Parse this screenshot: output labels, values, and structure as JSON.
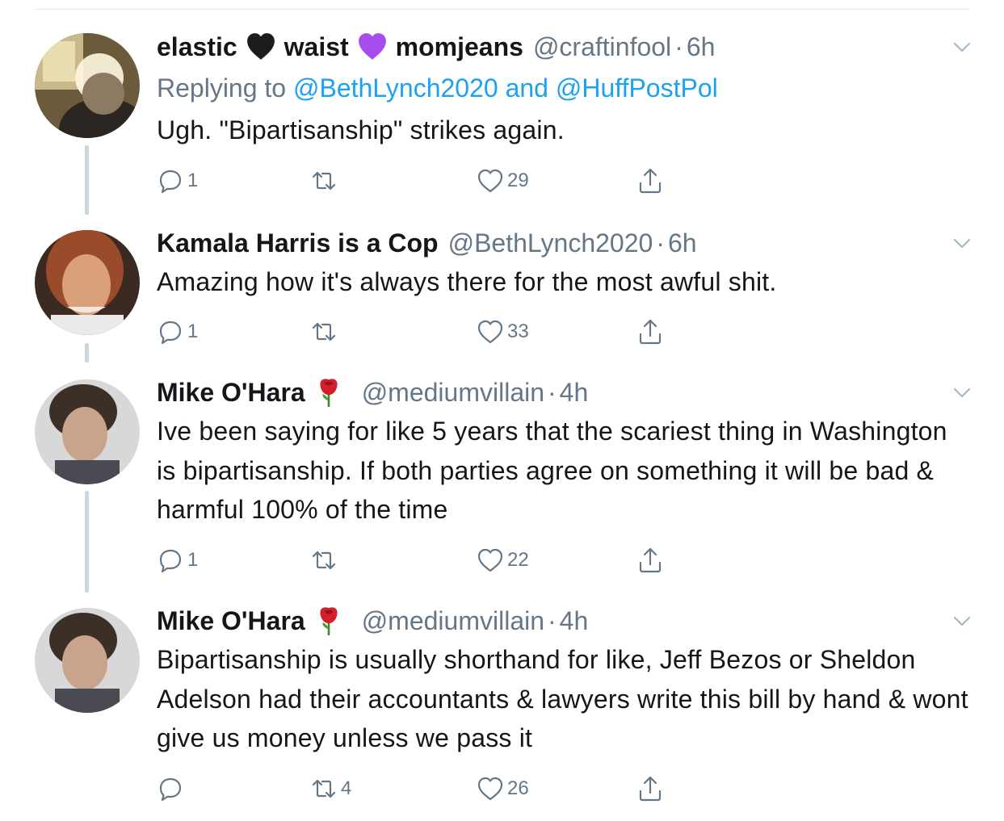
{
  "tweets": [
    {
      "name": "elastic",
      "name_part2": "waist",
      "name_part3": "momjeans",
      "handle": "@craftinfool",
      "time": "6h",
      "replying_prefix": "Replying to",
      "replying_to_1": "@BethLynch2020",
      "replying_and": "and",
      "replying_to_2": "@HuffPostPol",
      "text": "Ugh. \"Bipartisanship\" strikes again.",
      "replies": "1",
      "retweets": "",
      "likes": "29",
      "emoji_1": "black-heart-icon",
      "emoji_2": "purple-heart-icon"
    },
    {
      "name": "Kamala Harris is a Cop",
      "handle": "@BethLynch2020",
      "time": "6h",
      "text": "Amazing how it's always there for the most awful shit.",
      "replies": "1",
      "retweets": "",
      "likes": "33"
    },
    {
      "name": "Mike O'Hara",
      "handle": "@mediumvillain",
      "time": "4h",
      "text": "Ive been saying for like 5 years that the scariest thing in Washington is bipartisanship. If both parties agree on something it will be bad & harmful 100% of the time",
      "replies": "1",
      "retweets": "",
      "likes": "22",
      "emoji": "rose-icon"
    },
    {
      "name": "Mike O'Hara",
      "handle": "@mediumvillain",
      "time": "4h",
      "text": "Bipartisanship is usually shorthand for like, Jeff Bezos or Sheldon Adelson had their accountants & lawyers write this bill by hand & wont give us money unless we pass it",
      "replies": "",
      "retweets": "4",
      "likes": "26",
      "emoji": "rose-icon"
    }
  ],
  "separator": "·",
  "colors": {
    "text": "#14171a",
    "secondary": "#657786",
    "link": "#1da1f2",
    "thread_line": "#ccd6dd"
  }
}
